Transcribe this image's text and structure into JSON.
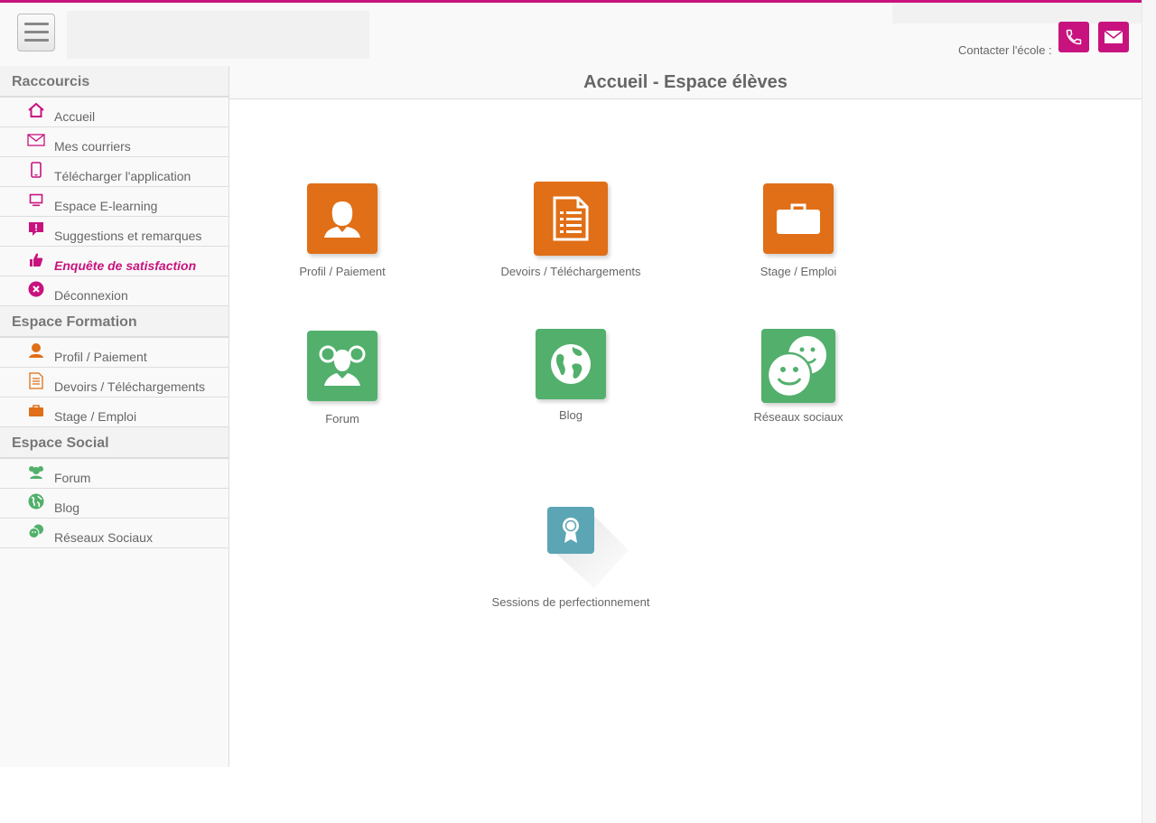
{
  "header": {
    "contact_label": "Contacter l'école :",
    "accent_color": "#c8137e"
  },
  "sidebar": {
    "sections": [
      {
        "title": "Raccourcis",
        "items": [
          {
            "label": "Accueil",
            "icon": "home-icon"
          },
          {
            "label": "Mes courriers",
            "icon": "mail-icon"
          },
          {
            "label": "Télécharger l'application",
            "icon": "mobile-icon"
          },
          {
            "label": "Espace E-learning",
            "icon": "monitor-icon"
          },
          {
            "label": "Suggestions et remarques",
            "icon": "comment-alert-icon"
          },
          {
            "label": "Enquête de satisfaction",
            "icon": "thumbs-up-icon",
            "highlighted": true
          },
          {
            "label": "Déconnexion",
            "icon": "close-circle-icon"
          }
        ]
      },
      {
        "title": "Espace Formation",
        "items": [
          {
            "label": "Profil / Paiement",
            "icon": "user-icon"
          },
          {
            "label": "Devoirs / Téléchargements",
            "icon": "document-list-icon"
          },
          {
            "label": "Stage / Emploi",
            "icon": "briefcase-icon"
          }
        ]
      },
      {
        "title": "Espace Social",
        "items": [
          {
            "label": "Forum",
            "icon": "users-icon"
          },
          {
            "label": "Blog",
            "icon": "globe-icon"
          },
          {
            "label": "Réseaux Sociaux",
            "icon": "smileys-icon"
          }
        ]
      }
    ]
  },
  "main": {
    "title": "Accueil - Espace élèves",
    "tiles": [
      {
        "label": "Profil / Paiement",
        "icon": "user-icon",
        "color": "#e06f17"
      },
      {
        "label": "Devoirs / Téléchargements",
        "icon": "document-list-icon",
        "color": "#e06f17"
      },
      {
        "label": "Stage / Emploi",
        "icon": "briefcase-icon",
        "color": "#e06f17"
      },
      {
        "label": "Forum",
        "icon": "users-icon",
        "color": "#52b06c"
      },
      {
        "label": "Blog",
        "icon": "globe-icon",
        "color": "#52b06c"
      },
      {
        "label": "Réseaux sociaux",
        "icon": "smileys-icon",
        "color": "#52b06c"
      },
      {
        "label": "Sessions de perfectionnement",
        "icon": "award-icon",
        "color": "#5ba5b5"
      }
    ]
  }
}
